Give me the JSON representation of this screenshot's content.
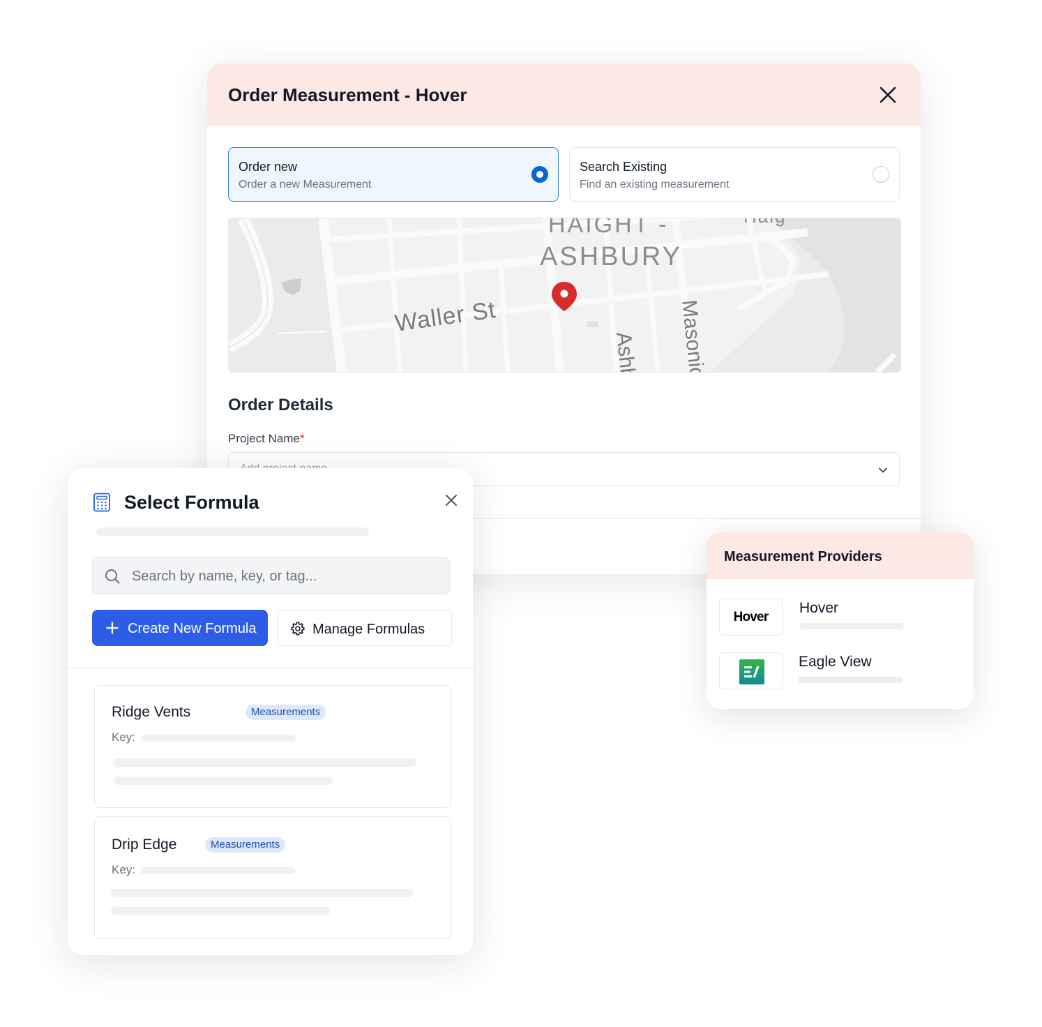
{
  "order_modal": {
    "title": "Order Measurement - Hover",
    "options": [
      {
        "title": "Order new",
        "subtitle": "Order a new Measurement",
        "selected": true
      },
      {
        "title": "Search Existing",
        "subtitle": "Find an existing measurement",
        "selected": false
      }
    ],
    "map": {
      "labels": {
        "district_line1": "HAIGHT -",
        "district_line2": "ASHBURY",
        "partial_top": "Haig",
        "street_waller": "Waller St",
        "street_ash": "Ashb",
        "street_masonic": "Masonic"
      },
      "pin_color": "#d62c2c"
    },
    "details_title": "Order Details",
    "project_name_label": "Project Name",
    "required_mark": "*",
    "project_name_placeholder": "Add project name"
  },
  "formula_panel": {
    "title": "Select Formula",
    "search_placeholder": "Search by name, key, or tag...",
    "create_button": "Create New Formula",
    "manage_button": "Manage Formulas",
    "cards": [
      {
        "name": "Ridge Vents",
        "tag": "Measurements",
        "key_label": "Key:"
      },
      {
        "name": "Drip Edge",
        "tag": "Measurements",
        "key_label": "Key:"
      }
    ]
  },
  "providers_panel": {
    "title": "Measurement Providers",
    "providers": [
      {
        "name": "Hover",
        "logo_text": "Hover"
      },
      {
        "name": "Eagle View",
        "logo_icon": "eagleview-logo-icon"
      }
    ]
  },
  "colors": {
    "header_tint": "#fde9e3",
    "primary": "#2d5de6",
    "radio_selected": "#0866cc",
    "tag_bg": "#dde9fb"
  }
}
